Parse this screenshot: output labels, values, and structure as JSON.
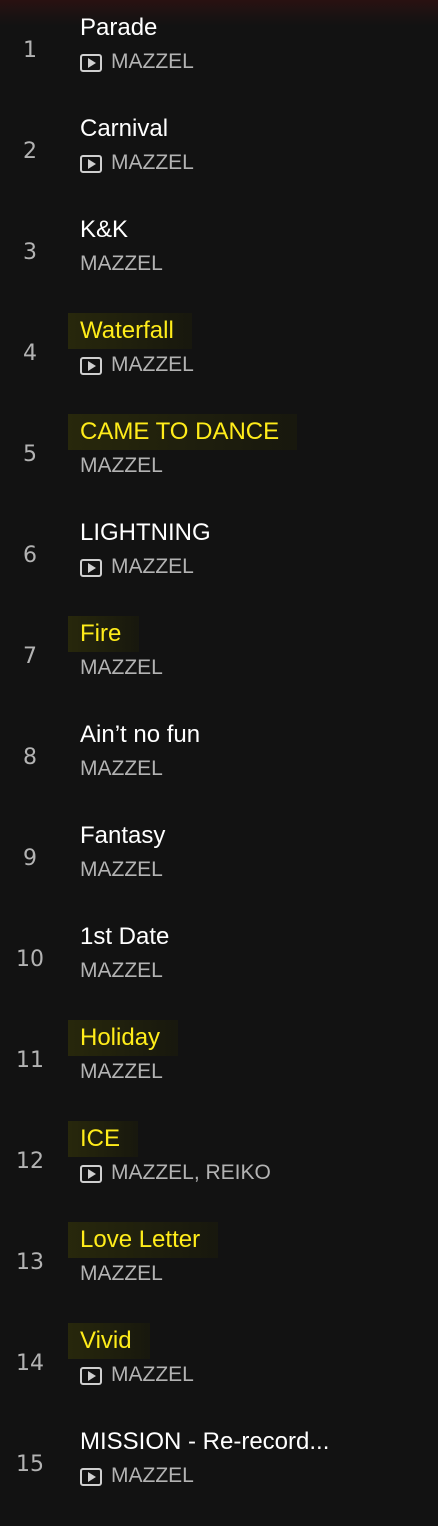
{
  "tracks": [
    {
      "number": "1",
      "title": "Parade",
      "artist": "MAZZEL",
      "has_video": true,
      "highlighted": false
    },
    {
      "number": "2",
      "title": "Carnival",
      "artist": "MAZZEL",
      "has_video": true,
      "highlighted": false
    },
    {
      "number": "3",
      "title": "K&K",
      "artist": "MAZZEL",
      "has_video": false,
      "highlighted": false
    },
    {
      "number": "4",
      "title": "Waterfall",
      "artist": "MAZZEL",
      "has_video": true,
      "highlighted": true
    },
    {
      "number": "5",
      "title": "CAME TO DANCE",
      "artist": "MAZZEL",
      "has_video": false,
      "highlighted": true
    },
    {
      "number": "6",
      "title": "LIGHTNING",
      "artist": "MAZZEL",
      "has_video": true,
      "highlighted": false
    },
    {
      "number": "7",
      "title": "Fire",
      "artist": "MAZZEL",
      "has_video": false,
      "highlighted": true
    },
    {
      "number": "8",
      "title": "Ain’t no fun",
      "artist": "MAZZEL",
      "has_video": false,
      "highlighted": false
    },
    {
      "number": "9",
      "title": "Fantasy",
      "artist": "MAZZEL",
      "has_video": false,
      "highlighted": false
    },
    {
      "number": "10",
      "title": "1st Date",
      "artist": "MAZZEL",
      "has_video": false,
      "highlighted": false
    },
    {
      "number": "11",
      "title": "Holiday",
      "artist": "MAZZEL",
      "has_video": false,
      "highlighted": true
    },
    {
      "number": "12",
      "title": "ICE",
      "artist": "MAZZEL, REIKO",
      "has_video": true,
      "highlighted": true
    },
    {
      "number": "13",
      "title": "Love Letter",
      "artist": "MAZZEL",
      "has_video": false,
      "highlighted": true
    },
    {
      "number": "14",
      "title": "Vivid",
      "artist": "MAZZEL",
      "has_video": true,
      "highlighted": true
    },
    {
      "number": "15",
      "title": "MISSION - Re-record...",
      "artist": "MAZZEL",
      "has_video": true,
      "highlighted": false
    }
  ],
  "icons": {
    "video": "video-icon"
  },
  "colors": {
    "background": "#121212",
    "title": "#ffffff",
    "highlight_title": "#ffec1a",
    "secondary": "#b3b3b3"
  }
}
